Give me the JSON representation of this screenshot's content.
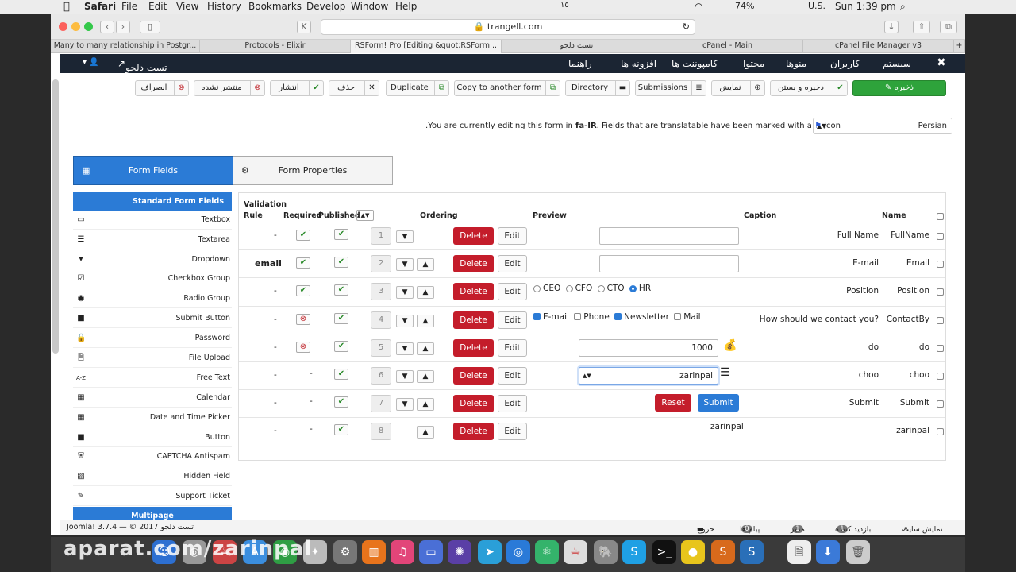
{
  "menubar": {
    "app": "Safari",
    "items": [
      "File",
      "Edit",
      "View",
      "History",
      "Bookmarks",
      "Develop",
      "Window",
      "Help"
    ],
    "battery": "74%",
    "input_source": "U.S.",
    "clock": "Sun 1:39 pm",
    "persian_num": "١٥"
  },
  "browser": {
    "url": "trangell.com",
    "tabs": [
      "Many to many relationship in Postgr...",
      "Protocols - Elixir",
      "RSForm! Pro [Editing &quot;RSForm...",
      "تست دلجو",
      "cPanel - Main",
      "cPanel File Manager v3"
    ],
    "new_tab": "+"
  },
  "admin_nav": {
    "site_name": "تست دلجو",
    "items": [
      "سیستم",
      "کاربران",
      "منوها",
      "محتوا",
      "کامپوننت ها",
      "افزونه ها",
      "راهنما"
    ]
  },
  "actions": {
    "save": "ذخیره",
    "save_close": "ذخیره و بستن",
    "preview": "نمایش",
    "submissions": "Submissions",
    "directory": "Directory",
    "copy": "Copy to another form",
    "duplicate": "Duplicate",
    "delete": "حذف",
    "publish": "انتشار",
    "unpublish": "منتشر نشده",
    "cancel": "انصراف"
  },
  "language": {
    "selected": "Persian",
    "notice_prefix": "You are currently editing this form in ",
    "notice_lang": "fa-IR",
    "notice_suffix": ". Fields that are translatable have been marked with a ",
    "notice_icon": "icon",
    "notice_period": "."
  },
  "panel_tabs": {
    "fields": "Form Fields",
    "properties": "Form Properties"
  },
  "sidebar": {
    "heading": "Standard Form Fields",
    "items": [
      {
        "label": "Textbox",
        "icon": "▭"
      },
      {
        "label": "Textarea",
        "icon": "☰"
      },
      {
        "label": "Dropdown",
        "icon": "▾"
      },
      {
        "label": "Checkbox Group",
        "icon": "☑"
      },
      {
        "label": "Radio Group",
        "icon": "◉"
      },
      {
        "label": "Submit Button",
        "icon": "■"
      },
      {
        "label": "Password",
        "icon": "🔒"
      },
      {
        "label": "File Upload",
        "icon": "🗎"
      },
      {
        "label": "Free Text",
        "icon": "A-Z"
      },
      {
        "label": "Calendar",
        "icon": "▦"
      },
      {
        "label": "Date and Time Picker",
        "icon": "▦"
      },
      {
        "label": "Button",
        "icon": "■"
      },
      {
        "label": "CAPTCHA Antispam",
        "icon": "⛨"
      },
      {
        "label": "Hidden Field",
        "icon": "▨"
      },
      {
        "label": "Support Ticket",
        "icon": "✎"
      }
    ],
    "multipage": "Multipage"
  },
  "grid": {
    "headers": {
      "validation": "Validation",
      "rule": "Rule",
      "required": "Required",
      "published": "Published",
      "ordering": "Ordering",
      "preview": "Preview",
      "caption": "Caption",
      "name": "Name"
    },
    "delete_label": "Delete",
    "edit_label": "Edit",
    "rows": [
      {
        "rule": "-",
        "required": "check",
        "published": "check",
        "order": "1",
        "caption": "Full Name",
        "name": "FullName"
      },
      {
        "rule": "email",
        "required": "check",
        "published": "check",
        "order": "2",
        "caption": "E-mail",
        "name": "Email"
      },
      {
        "rule": "-",
        "required": "check",
        "published": "check",
        "order": "3",
        "caption": "Position",
        "name": "Position"
      },
      {
        "rule": "-",
        "required": "x",
        "published": "check",
        "order": "4",
        "caption": "How should we contact you?",
        "name": "ContactBy"
      },
      {
        "rule": "-",
        "required": "x",
        "published": "check",
        "order": "5",
        "caption": "do",
        "name": "do"
      },
      {
        "rule": "-",
        "required": "-",
        "published": "check",
        "order": "6",
        "caption": "choo",
        "name": "choo"
      },
      {
        "rule": "-",
        "required": "-",
        "published": "check",
        "order": "7",
        "caption": "Submit",
        "name": "Submit"
      },
      {
        "rule": "-",
        "required": "-",
        "published": "check",
        "order": "8",
        "caption": "",
        "name": "zarinpal"
      }
    ],
    "previews": {
      "radios": [
        "CEO",
        "CFO",
        "CTO",
        "HR"
      ],
      "radio_selected": "HR",
      "checks": [
        "E-mail",
        "Phone",
        "Newsletter",
        "Mail"
      ],
      "checks_on": [
        "E-mail",
        "Newsletter"
      ],
      "amount": "1000",
      "select_value": "zarinpal",
      "reset": "Reset",
      "submit": "Submit",
      "zarinpal_text": "zarinpal"
    }
  },
  "statusbar": {
    "view_site": "نمایش سایت",
    "visitors": "بازدید کننده",
    "visitors_count": "1",
    "admin": "مدیر",
    "admin_count": "1",
    "messages": "پیام ها",
    "messages_count": "0",
    "logout": "خروج",
    "footer": "Joomla! 3.7.4 — © 2017 تست دلجو"
  },
  "watermark": "aparat.com/zarinpal"
}
